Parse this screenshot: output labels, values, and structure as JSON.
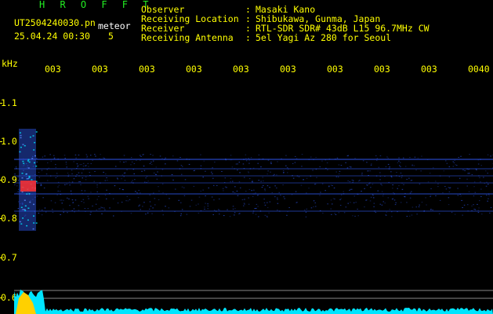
{
  "header": {
    "brand": "H R O F F T",
    "filename": "UT2504240030.pn",
    "meteor_label": "meteor",
    "datetime": "25.04.24 00:30",
    "count": "5",
    "info": [
      {
        "label": "Observer",
        "sep": ":",
        "value": "Masaki Kano"
      },
      {
        "label": "Receiving Location",
        "sep": ":",
        "value": "Shibukawa, Gunma, Japan"
      },
      {
        "label": "Receiver",
        "sep": ":",
        "value": "RTL-SDR SDR# 43dB L15 96.7MHz CW"
      },
      {
        "label": "Receiving Antenna",
        "sep": ":",
        "value": "5el Yagi Az 280 for Seoul"
      }
    ]
  },
  "axes": {
    "y_unit": "kHz",
    "y_ticks": [
      "1.1",
      "1.0",
      "0.9",
      "0.8",
      "0.7",
      "0.6"
    ],
    "x_ticks": [
      "003",
      "003",
      "003",
      "003",
      "003",
      "003",
      "003",
      "003",
      "003",
      "0040"
    ]
  },
  "colors": {
    "text": "#ffff00",
    "brand": "#22ee22",
    "background": "#000000",
    "signal": "#2a4fd8",
    "echo_core": "#ff3030",
    "noise_floor": "#00e5ff"
  }
}
